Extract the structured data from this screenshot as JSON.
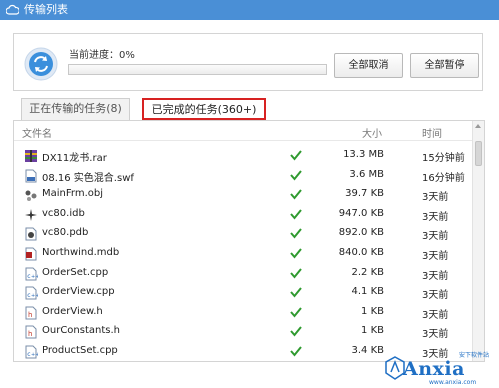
{
  "window": {
    "title": "传输列表"
  },
  "progress": {
    "label": "当前进度：0%",
    "fraction": 0.0
  },
  "buttons": {
    "cancel_all": "全部取消",
    "pause_all": "全部暂停"
  },
  "tabs": [
    {
      "label": "正在传输的任务(8)",
      "active": false
    },
    {
      "label": "已完成的任务(360+)",
      "active": true,
      "highlight": "#d72222"
    }
  ],
  "table": {
    "columns": [
      "文件名",
      "大小",
      "时间"
    ],
    "rows": [
      {
        "name": "DX11龙书.rar",
        "size": "13.3 MB",
        "time": "15分钟前",
        "icon": "archive-icon"
      },
      {
        "name": "08.16 实色混合.swf",
        "size": "3.6 MB",
        "time": "16分钟前",
        "icon": "flash-file-icon"
      },
      {
        "name": "MainFrm.obj",
        "size": "39.7 KB",
        "time": "3天前",
        "icon": "object-file-icon"
      },
      {
        "name": "vc80.idb",
        "size": "947.0 KB",
        "time": "3天前",
        "icon": "database-file-icon"
      },
      {
        "name": "vc80.pdb",
        "size": "892.0 KB",
        "time": "3天前",
        "icon": "debug-file-icon"
      },
      {
        "name": "Northwind.mdb",
        "size": "840.0 KB",
        "time": "3天前",
        "icon": "access-file-icon"
      },
      {
        "name": "OrderSet.cpp",
        "size": "2.2 KB",
        "time": "3天前",
        "icon": "cpp-file-icon"
      },
      {
        "name": "OrderView.cpp",
        "size": "4.1 KB",
        "time": "3天前",
        "icon": "cpp-file-icon"
      },
      {
        "name": "OrderView.h",
        "size": "1 KB",
        "time": "3天前",
        "icon": "header-file-icon"
      },
      {
        "name": "OurConstants.h",
        "size": "1 KB",
        "time": "3天前",
        "icon": "header-file-icon"
      },
      {
        "name": "ProductSet.cpp",
        "size": "3.4 KB",
        "time": "3天前",
        "icon": "cpp-file-icon"
      }
    ]
  },
  "watermark": {
    "logo_text": "Anxia",
    "small_text": "安下软件站",
    "bottom_text": "www.anxia.com"
  },
  "colors": {
    "titlebar": "#4a8fd6",
    "accent": "#4a9be0",
    "check": "#2f9a2f",
    "highlight": "#d72222"
  }
}
